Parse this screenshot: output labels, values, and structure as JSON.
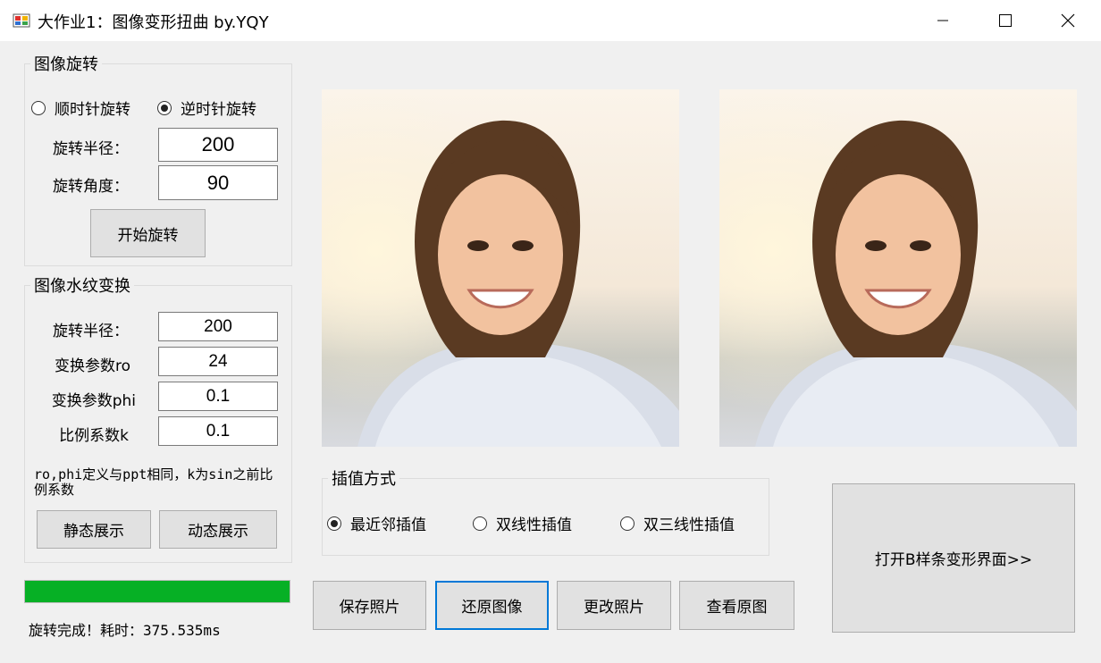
{
  "window": {
    "title": "大作业1：图像变形扭曲 by.YQY",
    "minimize_label": "—",
    "maximize_label": "☐",
    "close_label": "✕"
  },
  "rotation": {
    "group_title": "图像旋转",
    "radio_cw": "顺时针旋转",
    "radio_ccw": "逆时针旋转",
    "selected": "ccw",
    "radius_label": "旋转半径：",
    "radius_value": "200",
    "angle_label": "旋转角度：",
    "angle_value": "90",
    "start_button": "开始旋转"
  },
  "ripple": {
    "group_title": "图像水纹变换",
    "radius_label": "旋转半径：",
    "radius_value": "200",
    "ro_label": "变换参数ro",
    "ro_value": "24",
    "phi_label": "变换参数phi",
    "phi_value": "0.1",
    "k_label": "比例系数k",
    "k_value": "0.1",
    "note": "ro,phi定义与ppt相同，k为sin之前比例系数",
    "static_button": "静态展示",
    "dynamic_button": "动态展示"
  },
  "progress": {
    "value_percent": 100,
    "color": "#06b025"
  },
  "status": {
    "text": "旋转完成！耗时：375.535ms"
  },
  "interpolation": {
    "group_title": "插值方式",
    "options": [
      "最近邻插值",
      "双线性插值",
      "双三线性插值"
    ],
    "selected_index": 0
  },
  "actions": {
    "save": "保存照片",
    "restore": "还原图像",
    "change": "更改照片",
    "view_original": "查看原图",
    "open_bspline": "打开B样条变形界面>>"
  },
  "colors": {
    "focus_border": "#0078d7",
    "button_bg": "#e1e1e1",
    "window_bg": "#f0f0f0"
  }
}
